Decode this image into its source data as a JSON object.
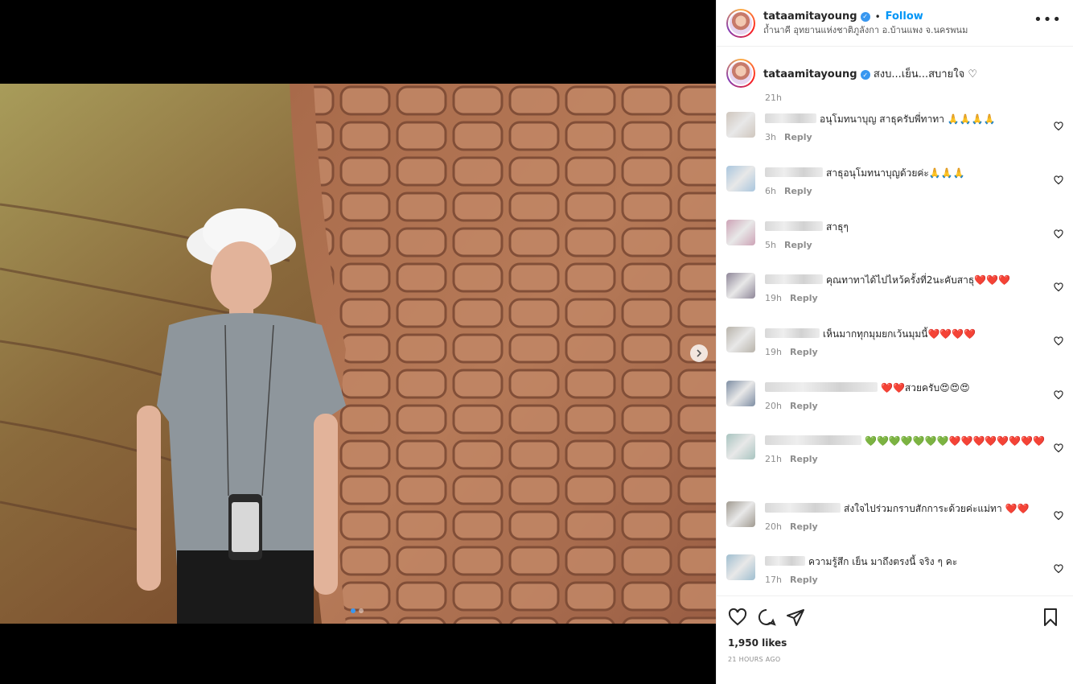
{
  "post": {
    "username": "tataamitayoung",
    "follow_label": "Follow",
    "separator": "•",
    "location": "ถ้ำนาคี อุทยานแห่งชาติภูลังกา อ.บ้านแพง จ.นครพนม",
    "more_label": "•••",
    "caption": "สงบ...เย็น...สบายใจ ♡",
    "caption_time": "21h",
    "likes": "1,950 likes",
    "timestamp": "21 HOURS AGO"
  },
  "media": {
    "slide_count": 2,
    "active_slide": 1,
    "next_icon": "chevron-right-icon"
  },
  "comments": [
    {
      "text": "อนุโมทนาบุญ สาธุครับพี่ทาทา 🙏🙏🙏🙏",
      "time": "3h",
      "reply": "Reply",
      "avatar_color": "#cfc6bd"
    },
    {
      "text": "สาธุอนุโมทนาบุญด้วยค่ะ🙏🙏🙏",
      "time": "6h",
      "reply": "Reply",
      "avatar_color": "#a9c6de"
    },
    {
      "text": "สาธุๆ",
      "time": "5h",
      "reply": "Reply",
      "avatar_color": "#cda3b6"
    },
    {
      "text": "คุณทาทาได้ไปไหว้ครั้งที่2นะคับสาธุ❤️❤️❤️",
      "time": "19h",
      "reply": "Reply",
      "avatar_color": "#8e8698"
    },
    {
      "text": "เห็นมากทุกมุมยกเว้นมุมนี้❤️❤️❤️❤️",
      "time": "19h",
      "reply": "Reply",
      "avatar_color": "#b8b3aa"
    },
    {
      "text": "❤️❤️สวยครับ😍😍😍",
      "time": "20h",
      "reply": "Reply",
      "avatar_color": "#7d8da3"
    },
    {
      "text": "💚💚💚💚💚💚💚❤️❤️❤️❤️❤️❤️❤️❤️",
      "time": "21h",
      "reply": "Reply",
      "avatar_color": "#a8c4c0"
    },
    {
      "text": "ส่งใจไปร่วมกราบสักการะด้วยค่ะแม่ทา ❤️❤️",
      "time": "20h",
      "reply": "Reply",
      "avatar_color": "#a09a90"
    },
    {
      "text": "ความรู้สึก เย็น มาถึงตรงนี้ จริง ๆ คะ",
      "time": "17h",
      "reply": "Reply",
      "avatar_color": "#9fbed0"
    }
  ],
  "colors": {
    "accent": "#0095f6",
    "verified": "#3897f0",
    "text": "#262626",
    "muted": "#8e8e8e"
  },
  "icons": {
    "like": "heart-icon",
    "comment": "comment-icon",
    "share": "share-icon",
    "save": "bookmark-icon"
  }
}
